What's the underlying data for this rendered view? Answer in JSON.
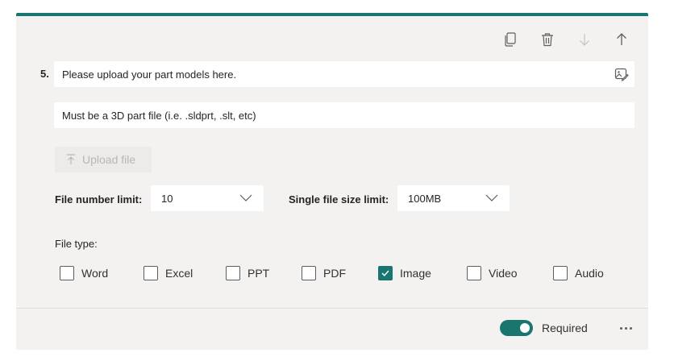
{
  "colors": {
    "accent": "#1a7571",
    "card_bg": "#f3f2f1",
    "disabled_text": "#b9b7b5"
  },
  "toolbar": {
    "icons": [
      "copy-icon",
      "delete-icon",
      "move-down-icon",
      "move-up-icon"
    ]
  },
  "question": {
    "number": "5.",
    "title": "Please upload your part models here.",
    "subtitle": "Must be a 3D part file (i.e. .sldprt, .slt, etc)",
    "title_icon": "insert-media-icon"
  },
  "upload": {
    "label": "Upload file",
    "icon": "upload-arrow-icon",
    "enabled": false
  },
  "limits": {
    "file_number_label": "File number limit:",
    "file_number_value": "10",
    "file_size_label": "Single file size limit:",
    "file_size_value": "100MB"
  },
  "file_type": {
    "label": "File type:",
    "options": [
      {
        "label": "Word",
        "checked": false
      },
      {
        "label": "Excel",
        "checked": false
      },
      {
        "label": "PPT",
        "checked": false
      },
      {
        "label": "PDF",
        "checked": false
      },
      {
        "label": "Image",
        "checked": true
      },
      {
        "label": "Video",
        "checked": false
      },
      {
        "label": "Audio",
        "checked": false
      }
    ]
  },
  "footer": {
    "required_label": "Required",
    "required_on": true,
    "more_icon": "more-options-icon"
  }
}
